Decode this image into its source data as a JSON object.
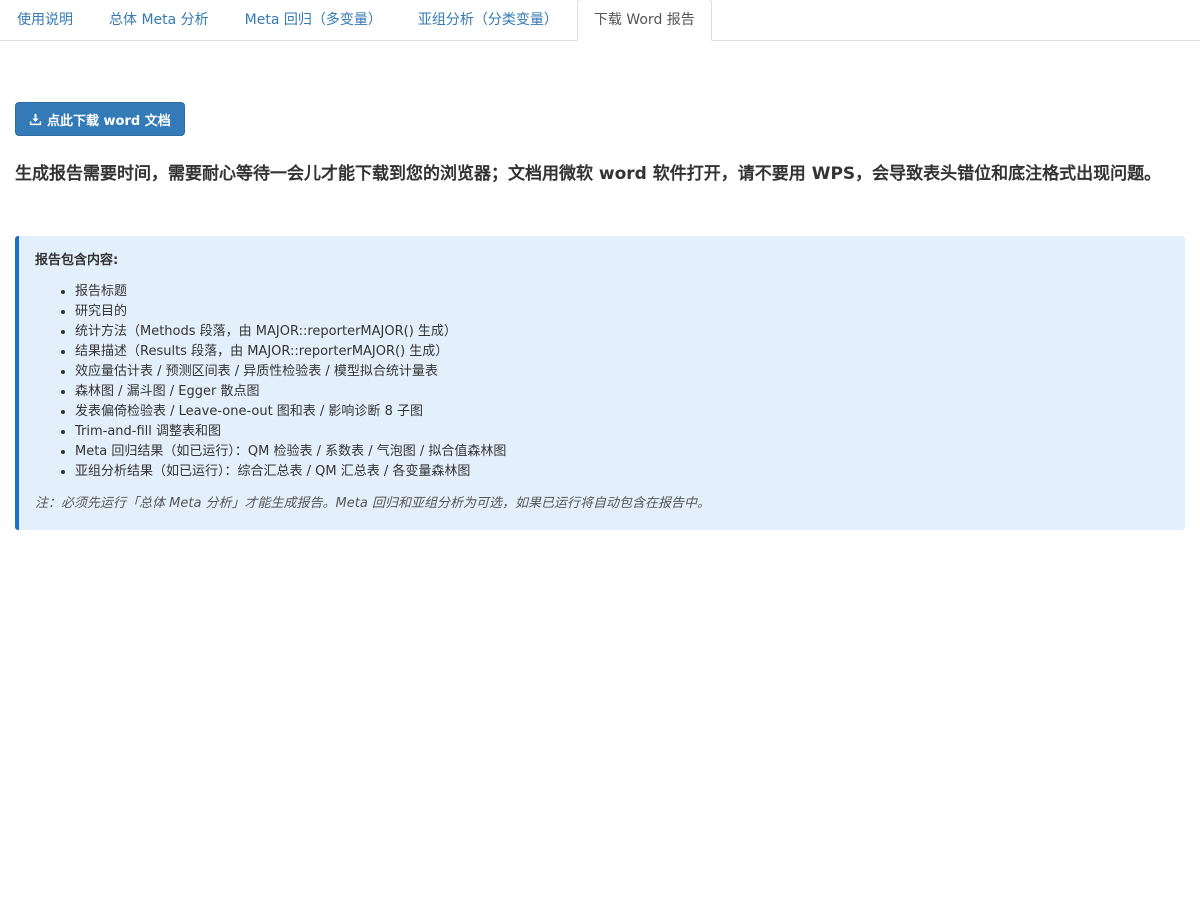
{
  "tabs": [
    {
      "label": "使用说明"
    },
    {
      "label": "总体 Meta 分析"
    },
    {
      "label": "Meta 回归（多变量）"
    },
    {
      "label": "亚组分析（分类变量）"
    },
    {
      "label": "下载 Word 报告"
    }
  ],
  "active_tab": "下载 Word 报告",
  "download_button": {
    "label": "点此下载 word 文档",
    "icon": "download-icon"
  },
  "notice": "生成报告需要时间，需要耐心等待一会儿才能下载到您的浏览器；文档用微软 word 软件打开，请不要用 WPS，会导致表头错位和底注格式出现问题。",
  "info": {
    "title": "报告包含内容:",
    "items": [
      "报告标题",
      "研究目的",
      "统计方法（Methods 段落，由 MAJOR::reporterMAJOR() 生成）",
      "结果描述（Results 段落，由 MAJOR::reporterMAJOR() 生成）",
      "效应量估计表 / 预测区间表 / 异质性检验表 / 模型拟合统计量表",
      "森林图 / 漏斗图 / Egger 散点图",
      "发表偏倚检验表 / Leave-one-out 图和表 / 影响诊断 8 子图",
      "Trim-and-fill 调整表和图",
      "Meta 回归结果（如已运行）：QM 检验表 / 系数表 / 气泡图 / 拟合值森林图",
      "亚组分析结果（如已运行）：综合汇总表 / QM 汇总表 / 各变量森林图"
    ],
    "note": "注：必须先运行「总体 Meta 分析」才能生成报告。Meta 回归和亚组分析为可选，如果已运行将自动包含在报告中。"
  },
  "colors": {
    "link": "#337ab7",
    "button": "#337ab7",
    "info_bg": "#e3f0fc",
    "info_border": "#1a6fc9"
  }
}
